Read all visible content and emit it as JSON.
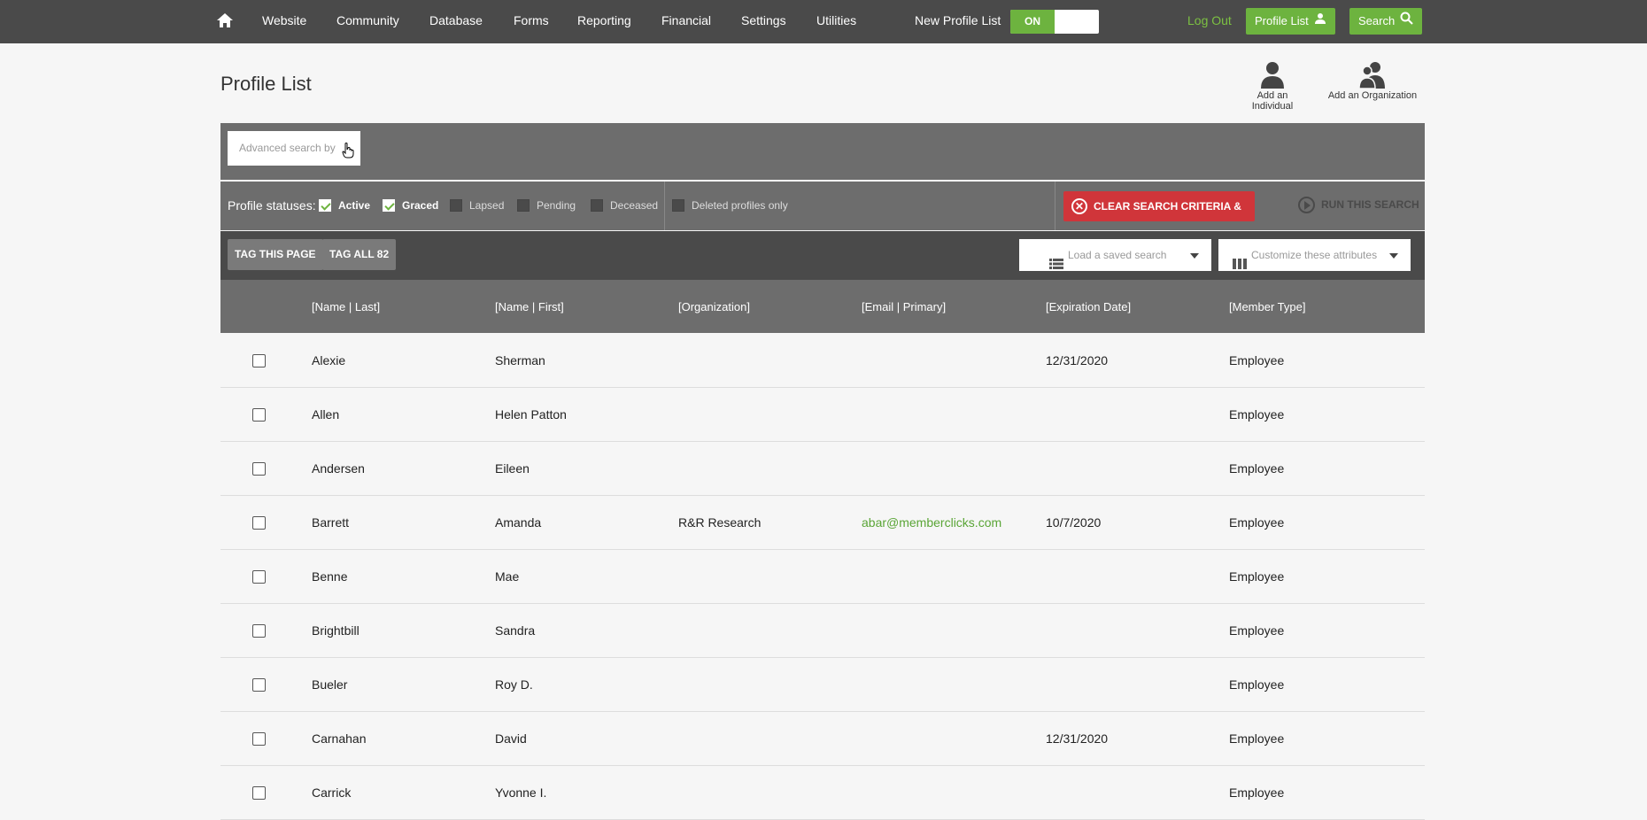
{
  "nav": {
    "items": [
      "Website",
      "Community",
      "Database",
      "Forms",
      "Reporting",
      "Financial",
      "Settings",
      "Utilities"
    ],
    "new_profile_list_label": "New Profile List",
    "toggle_on": "ON",
    "logout": "Log Out",
    "profile_list_btn": "Profile List",
    "search_btn": "Search"
  },
  "page": {
    "title": "Profile List",
    "add_individual": "Add an Individual",
    "add_organization": "Add an Organization"
  },
  "search": {
    "advanced_placeholder": "Advanced search by"
  },
  "statuses": {
    "label": "Profile statuses:",
    "items": [
      {
        "label": "Active",
        "checked": true
      },
      {
        "label": "Graced",
        "checked": true
      },
      {
        "label": "Lapsed",
        "checked": false
      },
      {
        "label": "Pending",
        "checked": false
      },
      {
        "label": "Deceased",
        "checked": false
      }
    ],
    "deleted_only": "Deleted profiles only",
    "clear_btn": "CLEAR SEARCH CRITERIA & VIEW ALL",
    "run_btn": "RUN THIS SEARCH"
  },
  "tagbar": {
    "tag_page": "TAG THIS PAGE",
    "tag_all": "TAG ALL 82",
    "load_saved": "Load a saved search",
    "customize": "Customize these attributes"
  },
  "table": {
    "headers": [
      "[Name | Last]",
      "[Name | First]",
      "[Organization]",
      "[Email | Primary]",
      "[Expiration Date]",
      "[Member Type]"
    ],
    "rows": [
      [
        "Alexie",
        "Sherman",
        "",
        "",
        "12/31/2020",
        "Employee"
      ],
      [
        "Allen",
        "Helen Patton",
        "",
        "",
        "",
        "Employee"
      ],
      [
        "Andersen",
        "Eileen",
        "",
        "",
        "",
        "Employee"
      ],
      [
        "Barrett",
        "Amanda",
        "R&R Research",
        "abar@memberclicks.com",
        "10/7/2020",
        "Employee"
      ],
      [
        "Benne",
        "Mae",
        "",
        "",
        "",
        "Employee"
      ],
      [
        "Brightbill",
        "Sandra",
        "",
        "",
        "",
        "Employee"
      ],
      [
        "Bueler",
        "Roy D.",
        "",
        "",
        "",
        "Employee"
      ],
      [
        "Carnahan",
        "David",
        "",
        "",
        "12/31/2020",
        "Employee"
      ],
      [
        "Carrick",
        "Yvonne I.",
        "",
        "",
        "",
        "Employee"
      ]
    ]
  },
  "colors": {
    "nav_bg": "#4a4a4a",
    "accent_green": "#6db33f",
    "clear_red": "#d0353a"
  }
}
